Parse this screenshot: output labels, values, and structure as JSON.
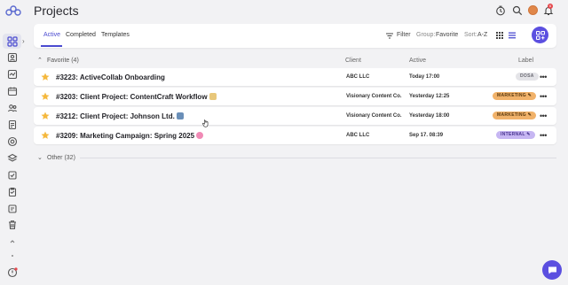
{
  "header": {
    "title": "Projects",
    "notification_count": "6"
  },
  "toolbar": {
    "tabs": [
      {
        "label": "Active"
      },
      {
        "label": "Completed"
      },
      {
        "label": "Templates"
      }
    ],
    "filter_label": "Filter",
    "group_prefix": "Group:",
    "group_value": "Favorite",
    "sort_prefix": "Sort:",
    "sort_value": "A-Z"
  },
  "columns": {
    "client": "Client",
    "active": "Active",
    "label": "Label"
  },
  "groups": {
    "favorite": "Favorite (4)",
    "other": "Other (32)"
  },
  "projects": [
    {
      "name": "#3223: ActiveCollab Onboarding",
      "client": "ABC LLC",
      "active": "Today 17:00",
      "label": "DOSA",
      "label_color": "#e4e4e8",
      "label_text_color": "#6a6a72",
      "emoji_color": ""
    },
    {
      "name": "#3203: Client Project: ContentCraft Workflow",
      "client": "Visionary Content Co.",
      "active": "Yesterday 12:25",
      "label": "MARKETING",
      "label_color": "#f1b26a",
      "label_text_color": "#5a3a10",
      "emoji_color": "#e8c77a"
    },
    {
      "name": "#3212: Client Project: Johnson Ltd.",
      "client": "Visionary Content Co.",
      "active": "Yesterday 18:00",
      "label": "MARKETING",
      "label_color": "#f1b26a",
      "label_text_color": "#5a3a10",
      "emoji_color": "#6a8fb8"
    },
    {
      "name": "#3209: Marketing Campaign: Spring 2025",
      "client": "ABC LLC",
      "active": "Sep 17. 08:39",
      "label": "INTERNAL",
      "label_color": "#c6b6f2",
      "label_text_color": "#4a3590",
      "emoji_color": "#f08ab5"
    }
  ],
  "colors": {
    "accent": "#4a4ad0",
    "brand_button": "#5b4fe0",
    "star": "#f5b83d"
  }
}
